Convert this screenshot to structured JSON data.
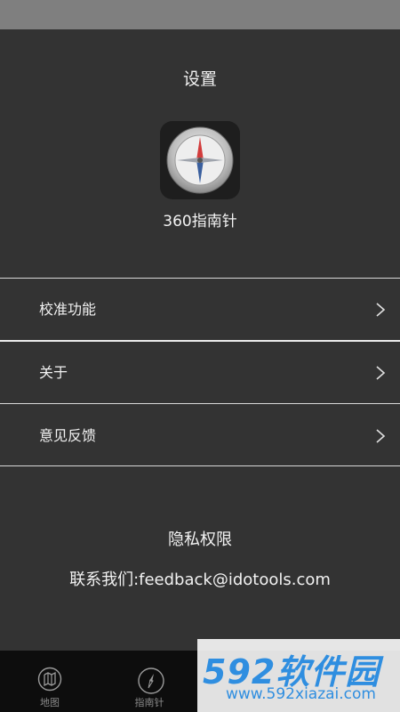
{
  "header": {
    "title": "设置"
  },
  "app": {
    "name": "360指南针"
  },
  "menu": {
    "items": [
      {
        "label": "校准功能"
      },
      {
        "label": "关于"
      },
      {
        "label": "意见反馈"
      }
    ]
  },
  "footer": {
    "privacy": "隐私权限",
    "contact": "联系我们:feedback@idotools.com"
  },
  "tabs": [
    {
      "label": "地图",
      "icon": "map-icon"
    },
    {
      "label": "指南针",
      "icon": "compass-icon"
    }
  ],
  "watermark": {
    "brand": "592软件园",
    "url": "www.592xiazai.com"
  },
  "colors": {
    "background": "#333333",
    "status_bar": "#7f7f7f",
    "tab_bar": "#0d0d0d",
    "watermark_blue": "#2f8ee0"
  }
}
